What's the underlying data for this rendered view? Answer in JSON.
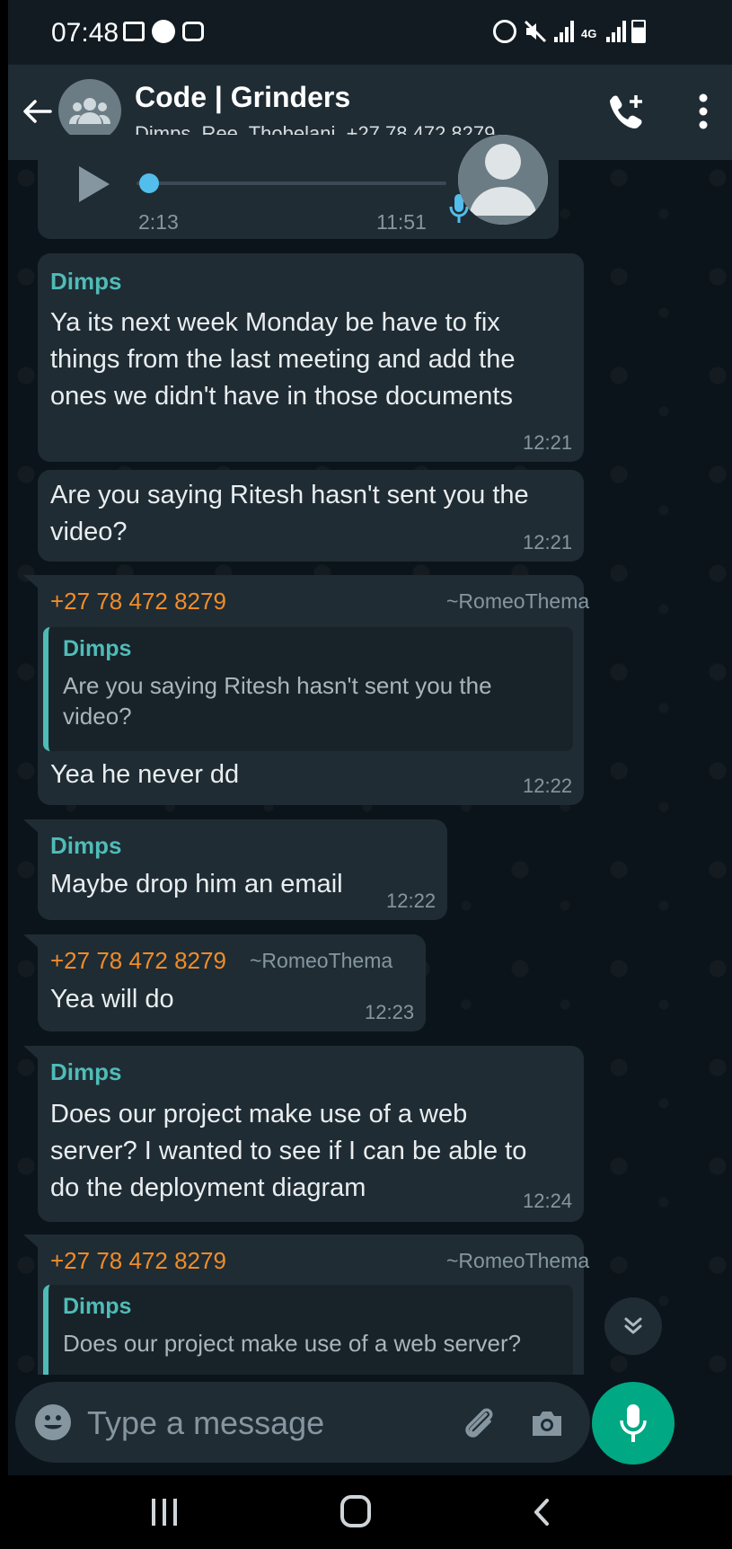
{
  "status_bar": {
    "time": "07:48",
    "network": "4G"
  },
  "header": {
    "title": "Code | Grinders",
    "subtitle": "Dimps, Ree, Thobelani, +27 78 472 8279,..."
  },
  "voice_note": {
    "elapsed": "2:13",
    "time": "11:51"
  },
  "messages": [
    {
      "sender": "Dimps",
      "text_lines": [
        "Ya its next week Monday be have to fix",
        "things from the last meeting and add the",
        "ones we didn't have in those documents"
      ],
      "time": "12:21"
    },
    {
      "text_lines": [
        "Are you saying Ritesh hasn't sent you the",
        "video?"
      ],
      "time": "12:21"
    },
    {
      "sender": "+27 78 472 8279",
      "alias": "~RomeoThema",
      "quote": {
        "sender": "Dimps",
        "lines": [
          "Are you saying Ritesh hasn't sent you the",
          "video?"
        ]
      },
      "text": "Yea he never dd",
      "time": "12:22"
    },
    {
      "sender": "Dimps",
      "text": "Maybe drop him an email",
      "time": "12:22"
    },
    {
      "sender": "+27 78 472 8279",
      "alias": "~RomeoThema",
      "text": "Yea will do",
      "time": "12:23"
    },
    {
      "sender": "Dimps",
      "text_lines": [
        "Does our project make use of a web",
        "server? I wanted to see if I can be able to",
        "do the deployment diagram"
      ],
      "time": "12:24"
    },
    {
      "sender": "+27 78 472 8279",
      "alias": "~RomeoThema",
      "quote": {
        "sender": "Dimps",
        "lines": [
          "Does our project make use of a web server?"
        ]
      }
    }
  ],
  "composer": {
    "placeholder": "Type a message"
  },
  "colors": {
    "accent": "#00a884",
    "bubble": "#1f2c34",
    "background": "#0b141a"
  }
}
